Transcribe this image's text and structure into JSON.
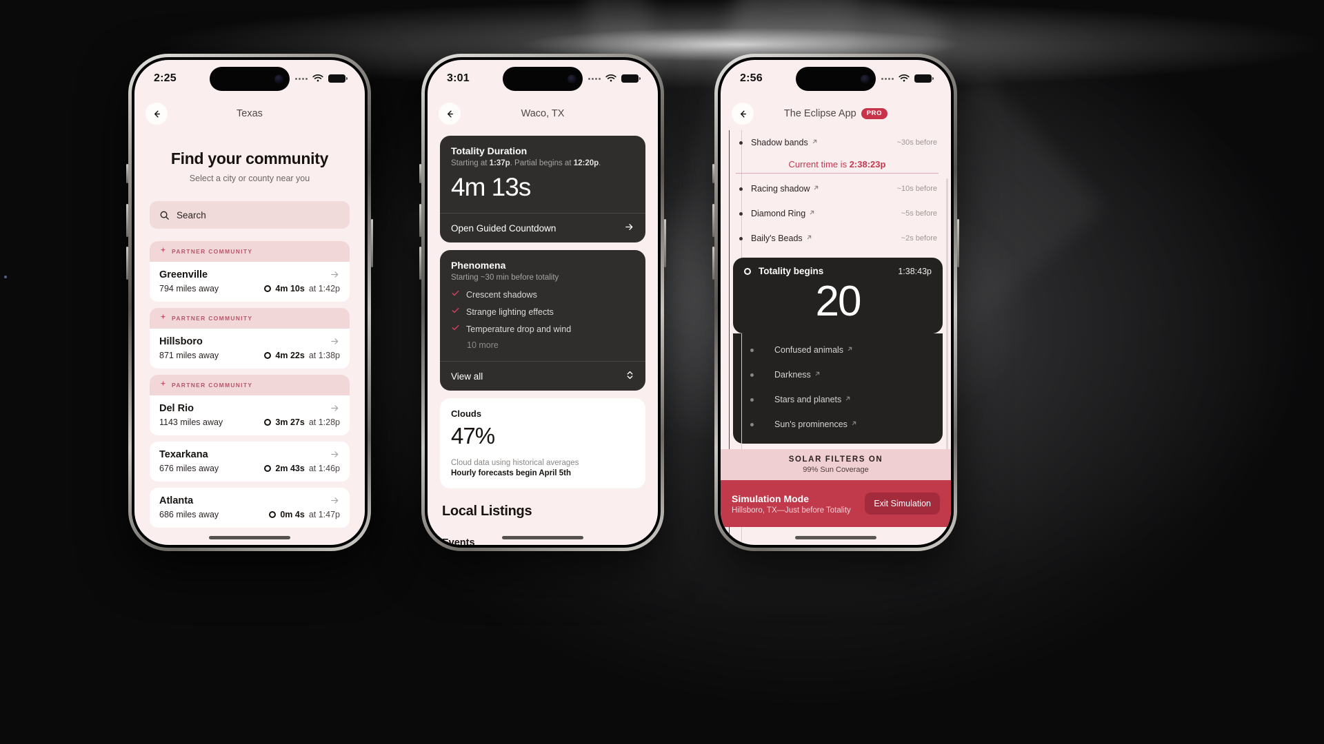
{
  "phones": [
    {
      "id": "phone-community",
      "status": {
        "time": "2:25"
      },
      "nav": {
        "title": "Texas",
        "back_icon": "arrow-left-icon"
      },
      "hero": {
        "title": "Find your community",
        "subtitle": "Select a city or county near you"
      },
      "search": {
        "placeholder": "Search",
        "icon": "search-icon"
      },
      "partner_label": "PARTNER COMMUNITY",
      "cities": [
        {
          "name": "Greenville",
          "distance": "794 miles away",
          "duration": "4m 10s",
          "at": "at 1:42p",
          "partner": true
        },
        {
          "name": "Hillsboro",
          "distance": "871 miles away",
          "duration": "4m 22s",
          "at": "at 1:38p",
          "partner": true
        },
        {
          "name": "Del Rio",
          "distance": "1143 miles away",
          "duration": "3m 27s",
          "at": "at 1:28p",
          "partner": true
        },
        {
          "name": "Texarkana",
          "distance": "676 miles away",
          "duration": "2m 43s",
          "at": "at 1:46p",
          "partner": false
        },
        {
          "name": "Atlanta",
          "distance": "686 miles away",
          "duration": "0m 4s",
          "at": "at 1:47p",
          "partner": false
        }
      ]
    },
    {
      "id": "phone-location-detail",
      "status": {
        "time": "3:01"
      },
      "nav": {
        "title": "Waco, TX",
        "back_icon": "arrow-left-icon"
      },
      "totality": {
        "title": "Totality Duration",
        "subtitle_pre": "Starting at ",
        "subtitle_start": "1:37p",
        "subtitle_mid": ". Partial begins at ",
        "subtitle_partial": "12:20p",
        "subtitle_end": ".",
        "value": "4m 13s",
        "action": "Open Guided Countdown"
      },
      "phenomena": {
        "title": "Phenomena",
        "subtitle": "Starting ~30 min before totality",
        "items": [
          "Crescent shadows",
          "Strange lighting effects",
          "Temperature drop and wind"
        ],
        "more": "10 more",
        "action": "View all"
      },
      "clouds": {
        "title": "Clouds",
        "value": "47%",
        "note": "Cloud data using historical averages",
        "note_bold": "Hourly forecasts begin April 5th"
      },
      "listings": {
        "heading": "Local Listings",
        "subheading": "Events"
      }
    },
    {
      "id": "phone-simulation",
      "status": {
        "time": "2:56"
      },
      "nav": {
        "title": "The Eclipse App",
        "badge": "PRO",
        "back_icon": "arrow-left-icon"
      },
      "timeline_before": [
        {
          "label": "Shadow bands",
          "when": "~30s before"
        }
      ],
      "current_time": {
        "prefix": "Current time is ",
        "value": "2:38:23p"
      },
      "timeline_mid": [
        {
          "label": "Racing shadow",
          "when": "~10s before"
        },
        {
          "label": "Diamond Ring",
          "when": "~5s before"
        },
        {
          "label": "Baily's Beads",
          "when": "~2s before"
        }
      ],
      "countdown": {
        "title": "Totality begins",
        "time": "1:38:43p",
        "value": "20"
      },
      "timeline_during": [
        {
          "label": "Confused animals"
        },
        {
          "label": "Darkness"
        },
        {
          "label": "Stars and planets"
        },
        {
          "label": "Sun's prominences"
        }
      ],
      "solar_bar": {
        "title": "SOLAR FILTERS ON",
        "subtitle": "99% Sun Coverage"
      },
      "sim_bar": {
        "title": "Simulation Mode",
        "subtitle": "Hillsboro, TX—Just before Totality",
        "button": "Exit Simulation"
      }
    }
  ],
  "colors": {
    "screen_bg": "#faeeee",
    "accent_red": "#c9334a",
    "partner_pink": "#f2d7d9",
    "dark_card": "#2f2e2d",
    "sim_red": "#c13a4c"
  }
}
